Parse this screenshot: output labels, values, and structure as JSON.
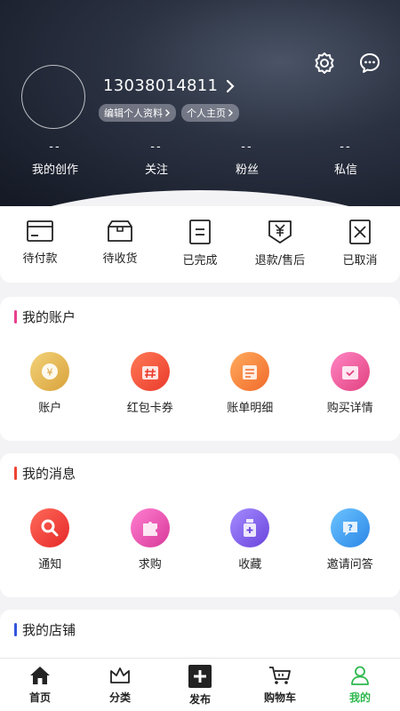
{
  "header": {
    "phone": "13038014811",
    "links": [
      "编辑个人资料",
      "个人主页"
    ],
    "stats": [
      {
        "value": "--",
        "label": "我的创作"
      },
      {
        "value": "--",
        "label": "关注"
      },
      {
        "value": "--",
        "label": "粉丝"
      },
      {
        "value": "--",
        "label": "私信"
      }
    ]
  },
  "orders": [
    {
      "label": "待付款",
      "icon": "wallet-icon"
    },
    {
      "label": "待收货",
      "icon": "package-icon"
    },
    {
      "label": "已完成",
      "icon": "document-icon"
    },
    {
      "label": "退款/售后",
      "icon": "yen-bag-icon"
    },
    {
      "label": "已取消",
      "icon": "cancel-icon"
    }
  ],
  "account": {
    "title": "我的账户",
    "accent": "#e8408f",
    "items": [
      {
        "label": "账户",
        "icon": "coin-icon",
        "color": "#e4b84a"
      },
      {
        "label": "红包卡券",
        "icon": "coupon-icon",
        "color": "#f2543f"
      },
      {
        "label": "账单明细",
        "icon": "bill-icon",
        "color": "#f57a3a"
      },
      {
        "label": "购买详情",
        "icon": "calendar-icon",
        "color": "#ec4f9a"
      }
    ]
  },
  "messages": {
    "title": "我的消息",
    "accent": "#ee4433",
    "items": [
      {
        "label": "通知",
        "icon": "search-notify-icon",
        "color": "#f03a3a"
      },
      {
        "label": "求购",
        "icon": "puzzle-icon",
        "color": "#e94aa6"
      },
      {
        "label": "收藏",
        "icon": "bottle-icon",
        "color": "#7d58e8"
      },
      {
        "label": "邀请问答",
        "icon": "question-icon",
        "color": "#3b9ff0"
      }
    ]
  },
  "shop": {
    "title": "我的店铺",
    "accent": "#3355dd"
  },
  "nav": [
    {
      "label": "首页",
      "icon": "home-icon"
    },
    {
      "label": "分类",
      "icon": "crown-icon"
    },
    {
      "label": "发布",
      "icon": "plus-icon"
    },
    {
      "label": "购物车",
      "icon": "cart-icon"
    },
    {
      "label": "我的",
      "icon": "user-icon",
      "active": true
    }
  ],
  "colors": {
    "active_nav": "#2db84d"
  }
}
